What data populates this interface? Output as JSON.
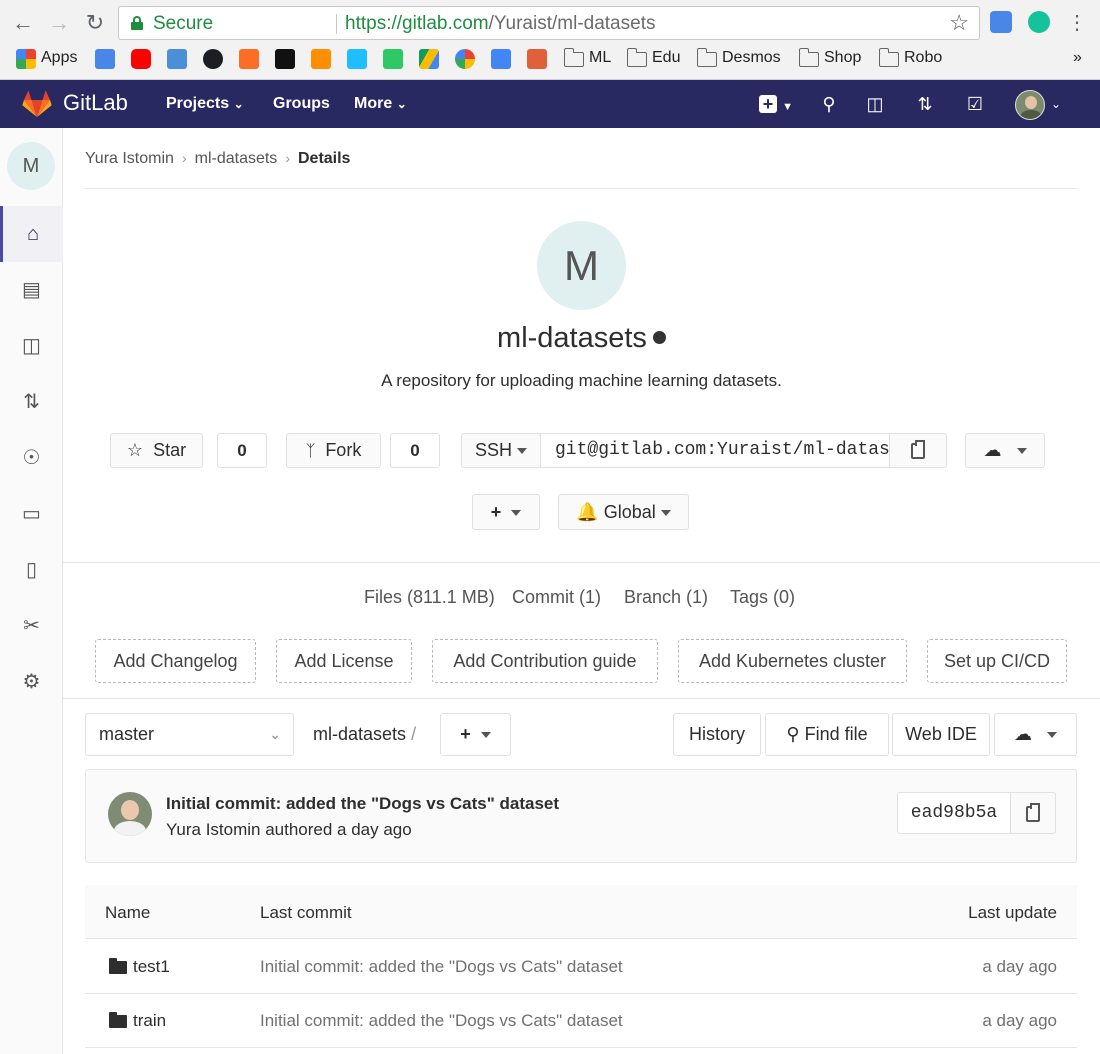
{
  "browser": {
    "secure_label": "Secure",
    "url_host": "https://gitlab.com",
    "url_path": "/Yuraist/ml-datasets",
    "bookmarks": [
      "Apps",
      "ML",
      "Edu",
      "Desmos",
      "Shop",
      "Robo"
    ],
    "more_bookmarks": "»"
  },
  "header": {
    "brand": "GitLab",
    "nav": [
      "Projects",
      "Groups",
      "More"
    ]
  },
  "sidebar": {
    "project_initial": "M",
    "items": [
      "home-icon",
      "document-icon",
      "issues-icon",
      "merge-request-icon",
      "ci-icon",
      "operations-icon",
      "wiki-icon",
      "snippets-icon",
      "settings-icon"
    ]
  },
  "breadcrumb": {
    "owner": "Yura Istomin",
    "project": "ml-datasets",
    "current": "Details"
  },
  "project": {
    "initial": "M",
    "name": "ml-datasets",
    "description": "A repository for uploading machine learning datasets.",
    "star_label": "Star",
    "star_count": "0",
    "fork_label": "Fork",
    "fork_count": "0",
    "clone_protocol": "SSH",
    "clone_url": "git@gitlab.com:Yuraist/ml-datasets.git",
    "notification_level": "Global"
  },
  "stats": {
    "files": "Files (811.1 MB)",
    "commits": "Commit (1)",
    "branches": "Branch (1)",
    "tags": "Tags (0)"
  },
  "quick_actions": [
    "Add Changelog",
    "Add License",
    "Add Contribution guide",
    "Add Kubernetes cluster",
    "Set up CI/CD"
  ],
  "repo_bar": {
    "branch": "master",
    "path": "ml-datasets",
    "path_sep": "/",
    "history": "History",
    "find_file": "Find file",
    "web_ide": "Web IDE"
  },
  "last_commit": {
    "title": "Initial commit: added the \"Dogs vs Cats\" dataset",
    "author_line": "Yura Istomin authored a day ago",
    "sha": "ead98b5a"
  },
  "files_table": {
    "headers": [
      "Name",
      "Last commit",
      "Last update"
    ],
    "rows": [
      {
        "name": "test1",
        "commit": "Initial commit: added the \"Dogs vs Cats\" dataset",
        "updated": "a day ago"
      },
      {
        "name": "train",
        "commit": "Initial commit: added the \"Dogs vs Cats\" dataset",
        "updated": "a day ago"
      }
    ]
  }
}
